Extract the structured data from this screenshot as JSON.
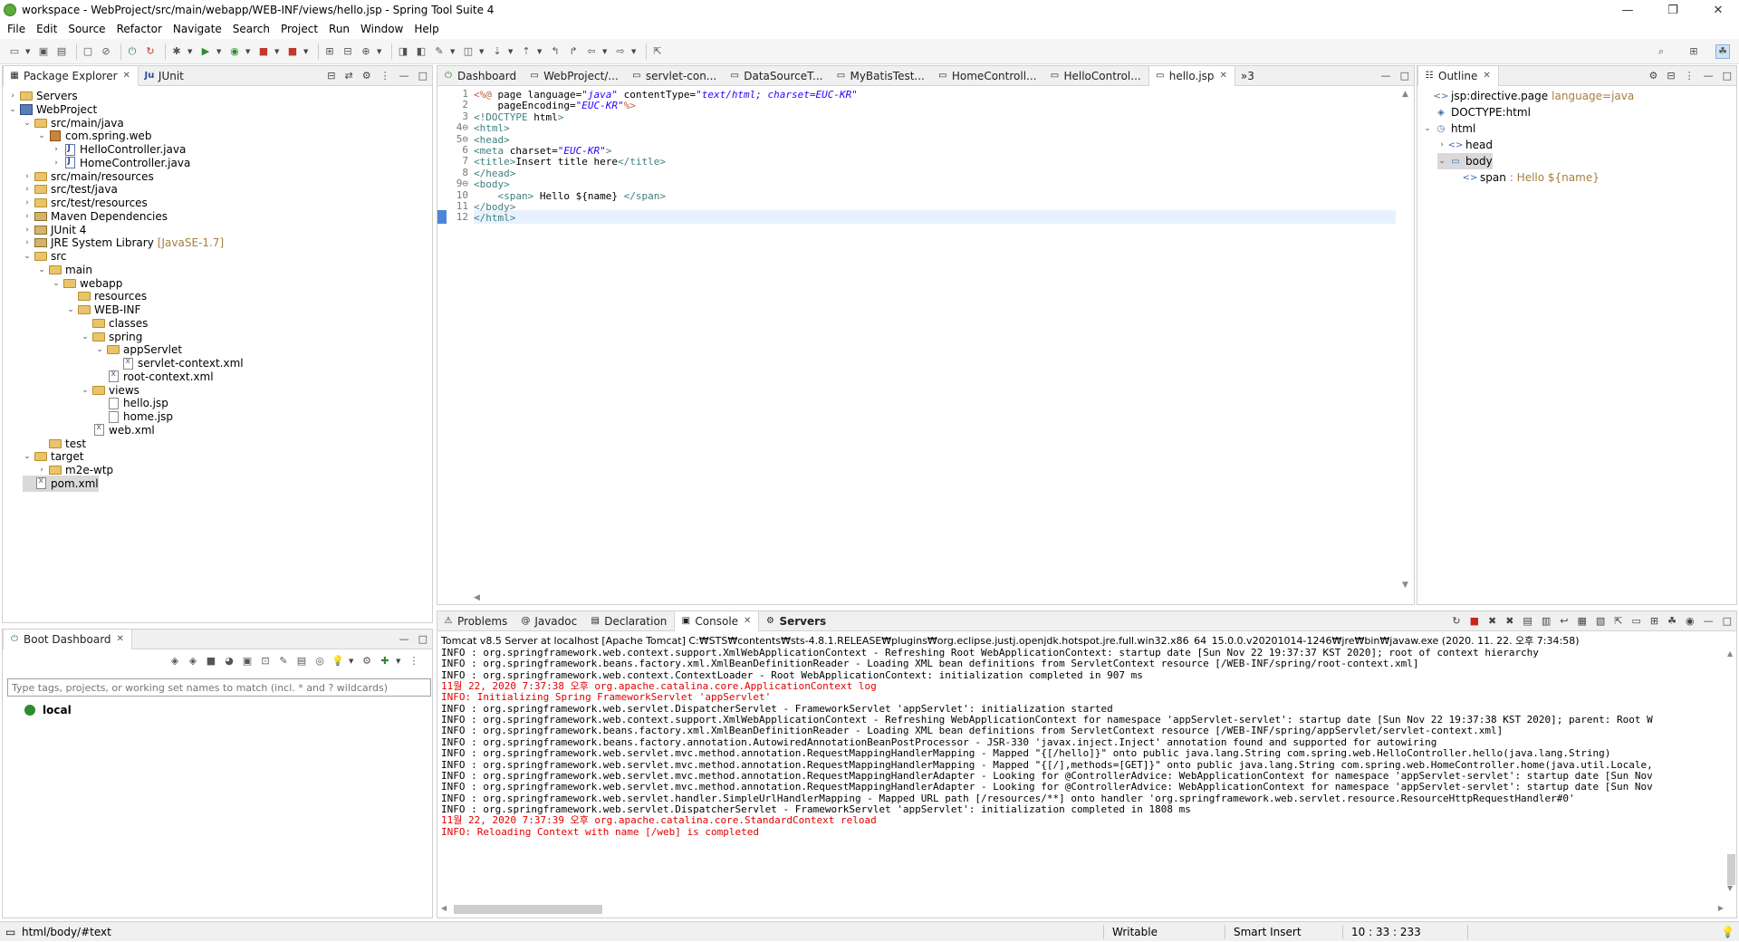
{
  "window": {
    "title": "workspace - WebProject/src/main/webapp/WEB-INF/views/hello.jsp - Spring Tool Suite 4",
    "controls": [
      "—",
      "❐",
      "✕"
    ]
  },
  "menu": [
    "File",
    "Edit",
    "Source",
    "Refactor",
    "Navigate",
    "Search",
    "Project",
    "Run",
    "Window",
    "Help"
  ],
  "explorer": {
    "tabs": [
      {
        "label": "Package Explorer",
        "close": "✕"
      },
      {
        "label": "JUnit"
      }
    ],
    "tree": [
      {
        "label": "Servers",
        "expander": "›",
        "icon": "folder"
      },
      {
        "label": "WebProject",
        "expander": "⌄",
        "icon": "project"
      },
      {
        "label": "src/main/java",
        "expander": "⌄",
        "icon": "folder"
      },
      {
        "label": "com.spring.web",
        "expander": "⌄",
        "icon": "pkg"
      },
      {
        "label": "HelloController.java",
        "expander": "›",
        "icon": "java"
      },
      {
        "label": "HomeController.java",
        "expander": "›",
        "icon": "java"
      },
      {
        "label": "src/main/resources",
        "expander": "›",
        "icon": "folder"
      },
      {
        "label": "src/test/java",
        "expander": "›",
        "icon": "folder"
      },
      {
        "label": "src/test/resources",
        "expander": "›",
        "icon": "folder"
      },
      {
        "label": "Maven Dependencies",
        "expander": "›",
        "icon": "lib"
      },
      {
        "label": "JUnit 4",
        "expander": "›",
        "icon": "lib"
      },
      {
        "label": "JRE System Library",
        "suffix": "[JavaSE-1.7]",
        "expander": "›",
        "icon": "lib"
      },
      {
        "label": "src",
        "expander": "⌄",
        "icon": "folder"
      },
      {
        "label": "main",
        "expander": "⌄",
        "icon": "folder"
      },
      {
        "label": "webapp",
        "expander": "⌄",
        "icon": "folder"
      },
      {
        "label": "resources",
        "expander": "",
        "icon": "folder"
      },
      {
        "label": "WEB-INF",
        "expander": "⌄",
        "icon": "folder"
      },
      {
        "label": "classes",
        "expander": "",
        "icon": "folder"
      },
      {
        "label": "spring",
        "expander": "⌄",
        "icon": "folder"
      },
      {
        "label": "appServlet",
        "expander": "⌄",
        "icon": "folder"
      },
      {
        "label": "servlet-context.xml",
        "expander": "",
        "icon": "xml"
      },
      {
        "label": "root-context.xml",
        "expander": "",
        "icon": "xml"
      },
      {
        "label": "views",
        "expander": "⌄",
        "icon": "folder"
      },
      {
        "label": "hello.jsp",
        "expander": "",
        "icon": "jsp"
      },
      {
        "label": "home.jsp",
        "expander": "",
        "icon": "jsp"
      },
      {
        "label": "web.xml",
        "expander": "",
        "icon": "xml"
      },
      {
        "label": "test",
        "expander": "",
        "icon": "folder"
      },
      {
        "label": "target",
        "expander": "⌄",
        "icon": "folder"
      },
      {
        "label": "m2e-wtp",
        "expander": "›",
        "icon": "folder"
      },
      {
        "label": "pom.xml",
        "expander": "",
        "icon": "xml",
        "selected": true
      }
    ]
  },
  "boot_dashboard": {
    "tab": "Boot Dashboard",
    "filter_placeholder": "Type tags, projects, or working set names to match (incl. * and ? wildcards)",
    "item": "local"
  },
  "editor": {
    "tabs": [
      "Dashboard",
      "WebProject/...",
      "servlet-con...",
      "DataSourceT...",
      "MyBatisTest...",
      "HomeControll...",
      "HelloControl...",
      "hello.jsp"
    ],
    "active_tab": "hello.jsp",
    "overflow": "»3",
    "lines": [
      {
        "n": "1",
        "code": "<%@ page language=\"java\" contentType=\"text/html; charset=EUC-KR\""
      },
      {
        "n": "2",
        "code": "    pageEncoding=\"EUC-KR\"%>"
      },
      {
        "n": "3",
        "code": "<!DOCTYPE html>"
      },
      {
        "n": "4⊖",
        "code": "<html>"
      },
      {
        "n": "5⊖",
        "code": "<head>"
      },
      {
        "n": "6",
        "code": "<meta charset=\"EUC-KR\">"
      },
      {
        "n": "7",
        "code": "<title>Insert title here</title>"
      },
      {
        "n": "8",
        "code": "</head>"
      },
      {
        "n": "9⊖",
        "code": "<body>"
      },
      {
        "n": "10",
        "code": "    <span> Hello ${name} </span>"
      },
      {
        "n": "11",
        "code": "</body>"
      },
      {
        "n": "12",
        "code": "</html>"
      }
    ]
  },
  "outline": {
    "tab": "Outline",
    "items": [
      {
        "label": "jsp:directive.page",
        "suffix": "language=java",
        "expander": "",
        "icon": "<>"
      },
      {
        "label": "DOCTYPE:html",
        "expander": "",
        "icon": "◈"
      },
      {
        "label": "html",
        "expander": "⌄",
        "icon": "◷"
      },
      {
        "label": "head",
        "expander": "›",
        "icon": "<>"
      },
      {
        "label": "body",
        "expander": "⌄",
        "icon": "▭",
        "selected": true
      },
      {
        "label": "span",
        "suffix": ": Hello ${name}",
        "expander": "",
        "icon": "<>"
      }
    ]
  },
  "console": {
    "tabs": [
      "Problems",
      "Javadoc",
      "Declaration",
      "Console",
      "Servers"
    ],
    "active_tab": "Console",
    "header": "Tomcat v8.5 Server at localhost [Apache Tomcat] C:₩STS₩contents₩sts-4.8.1.RELEASE₩plugins₩org.eclipse.justj.openjdk.hotspot.jre.full.win32.x86_64_15.0.0.v20201014-1246₩jre₩bin₩javaw.exe  (2020. 11. 22. 오후 7:34:58)",
    "lines": [
      {
        "text": "INFO : org.springframework.web.context.support.XmlWebApplicationContext - Refreshing Root WebApplicationContext: startup date [Sun Nov 22 19:37:37 KST 2020]; root of context hierarchy",
        "red": false
      },
      {
        "text": "INFO : org.springframework.beans.factory.xml.XmlBeanDefinitionReader - Loading XML bean definitions from ServletContext resource [/WEB-INF/spring/root-context.xml]",
        "red": false
      },
      {
        "text": "INFO : org.springframework.web.context.ContextLoader - Root WebApplicationContext: initialization completed in 907 ms",
        "red": false
      },
      {
        "text": "11월 22, 2020 7:37:38 오후 org.apache.catalina.core.ApplicationContext log",
        "red": true
      },
      {
        "text": "INFO: Initializing Spring FrameworkServlet 'appServlet'",
        "red": true
      },
      {
        "text": "INFO : org.springframework.web.servlet.DispatcherServlet - FrameworkServlet 'appServlet': initialization started",
        "red": false
      },
      {
        "text": "INFO : org.springframework.web.context.support.XmlWebApplicationContext - Refreshing WebApplicationContext for namespace 'appServlet-servlet': startup date [Sun Nov 22 19:37:38 KST 2020]; parent: Root W",
        "red": false
      },
      {
        "text": "INFO : org.springframework.beans.factory.xml.XmlBeanDefinitionReader - Loading XML bean definitions from ServletContext resource [/WEB-INF/spring/appServlet/servlet-context.xml]",
        "red": false
      },
      {
        "text": "INFO : org.springframework.beans.factory.annotation.AutowiredAnnotationBeanPostProcessor - JSR-330 'javax.inject.Inject' annotation found and supported for autowiring",
        "red": false
      },
      {
        "text": "INFO : org.springframework.web.servlet.mvc.method.annotation.RequestMappingHandlerMapping - Mapped \"{[/hello]}\" onto public java.lang.String com.spring.web.HelloController.hello(java.lang.String)",
        "red": false
      },
      {
        "text": "INFO : org.springframework.web.servlet.mvc.method.annotation.RequestMappingHandlerMapping - Mapped \"{[/],methods=[GET]}\" onto public java.lang.String com.spring.web.HomeController.home(java.util.Locale,",
        "red": false
      },
      {
        "text": "INFO : org.springframework.web.servlet.mvc.method.annotation.RequestMappingHandlerAdapter - Looking for @ControllerAdvice: WebApplicationContext for namespace 'appServlet-servlet': startup date [Sun Nov",
        "red": false
      },
      {
        "text": "INFO : org.springframework.web.servlet.mvc.method.annotation.RequestMappingHandlerAdapter - Looking for @ControllerAdvice: WebApplicationContext for namespace 'appServlet-servlet': startup date [Sun Nov",
        "red": false
      },
      {
        "text": "INFO : org.springframework.web.servlet.handler.SimpleUrlHandlerMapping - Mapped URL path [/resources/**] onto handler 'org.springframework.web.servlet.resource.ResourceHttpRequestHandler#0'",
        "red": false
      },
      {
        "text": "INFO : org.springframework.web.servlet.DispatcherServlet - FrameworkServlet 'appServlet': initialization completed in 1808 ms",
        "red": false
      },
      {
        "text": "11월 22, 2020 7:37:39 오후 org.apache.catalina.core.StandardContext reload",
        "red": true
      },
      {
        "text": "INFO: Reloading Context with name [/web] is completed",
        "red": true
      }
    ]
  },
  "status": {
    "path": "html/body/#text",
    "mode": "Writable",
    "insert": "Smart Insert",
    "position": "10 : 33 : 233"
  }
}
